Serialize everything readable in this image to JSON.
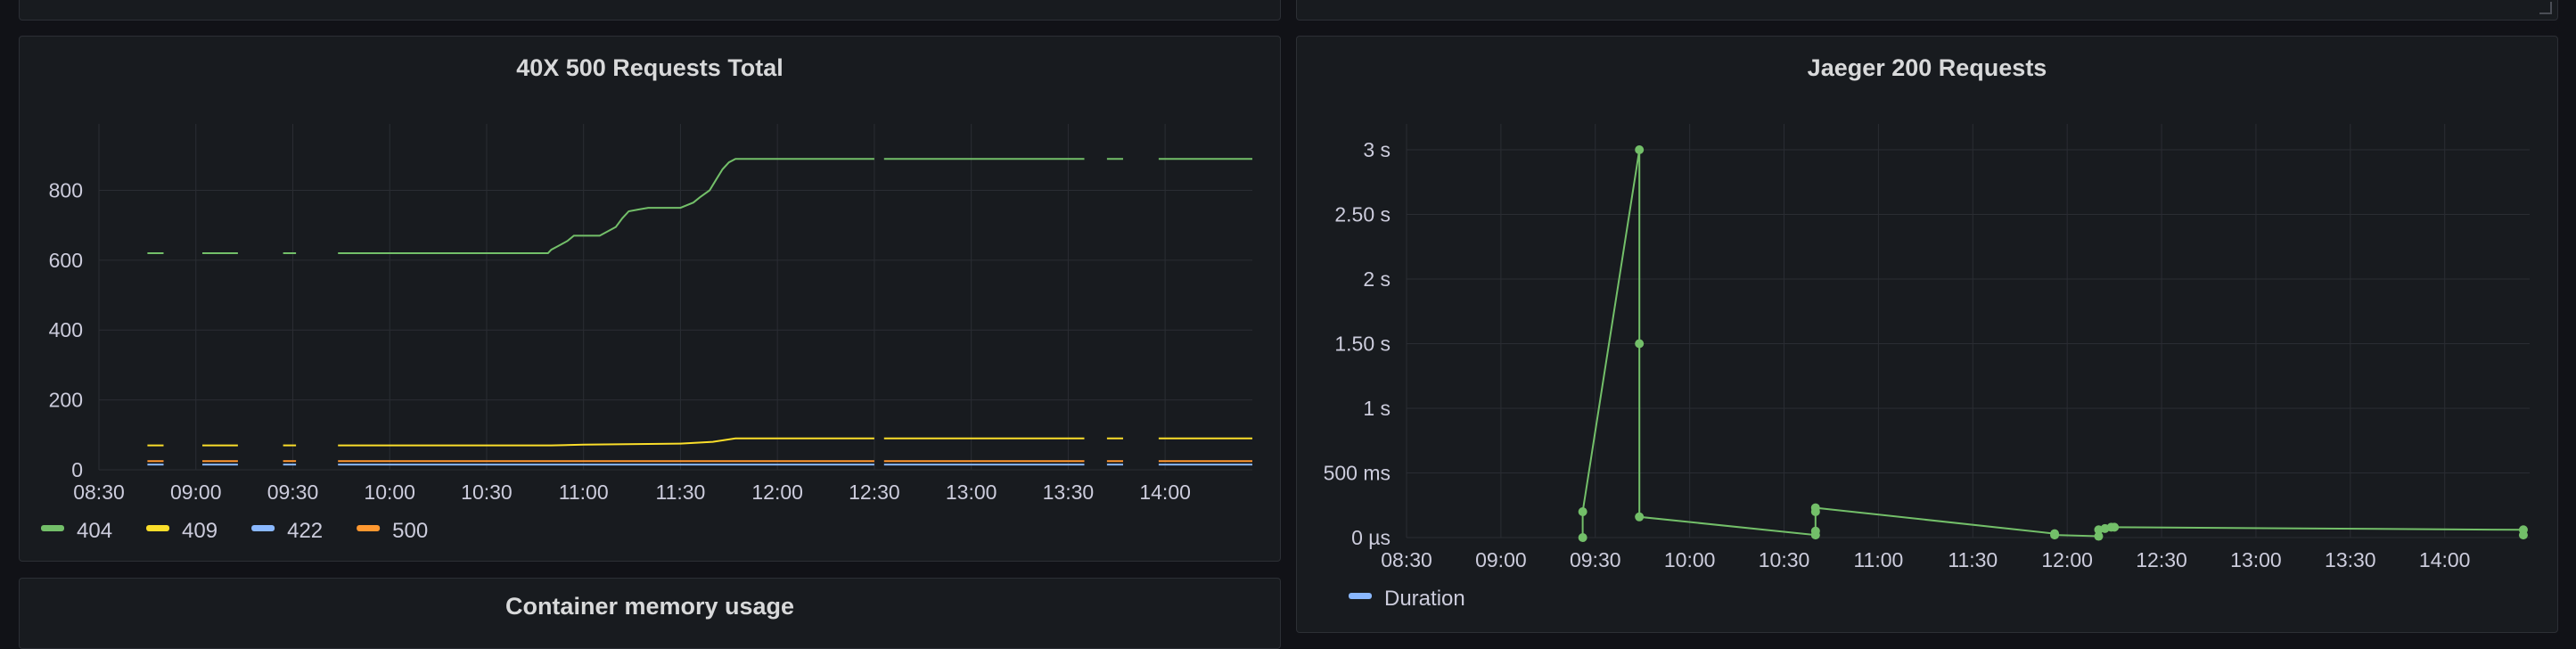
{
  "dashboard": {
    "panels": {
      "requests_total": {
        "title": "40X 500 Requests Total"
      },
      "jaeger": {
        "title": "Jaeger 200 Requests"
      },
      "memory": {
        "title": "Container memory usage"
      }
    }
  },
  "colors": {
    "404": "#73bf69",
    "409": "#fade2a",
    "422": "#8ab8ff",
    "500": "#ff9830",
    "Duration_line": "#73bf69",
    "Duration_legend": "#8ab8ff"
  },
  "chart_data": [
    {
      "type": "line",
      "title": "40X 500 Requests Total",
      "x_ticks": [
        "08:30",
        "09:00",
        "09:30",
        "10:00",
        "10:30",
        "11:00",
        "11:30",
        "12:00",
        "12:30",
        "13:00",
        "13:30",
        "14:00"
      ],
      "y_ticks": [
        "0",
        "200",
        "400",
        "600",
        "800"
      ],
      "xlim": [
        "08:30",
        "14:27"
      ],
      "ylim": [
        0,
        990
      ],
      "grid": true,
      "legend_position": "bottom-left",
      "series": [
        {
          "name": "404",
          "color": "#73bf69",
          "segments": [
            [
              [
                "08:45",
                620
              ],
              [
                "08:50",
                620
              ]
            ],
            [
              [
                "09:02",
                620
              ],
              [
                "09:13",
                620
              ]
            ],
            [
              [
                "09:27",
                620
              ],
              [
                "09:31",
                620
              ]
            ],
            [
              [
                "09:44",
                620
              ],
              [
                "10:00",
                620
              ],
              [
                "10:30",
                620
              ],
              [
                "10:49",
                620
              ],
              [
                "10:50",
                630
              ],
              [
                "10:52",
                640
              ],
              [
                "10:55",
                655
              ],
              [
                "10:57",
                670
              ],
              [
                "11:00",
                670
              ],
              [
                "11:05",
                670
              ],
              [
                "11:10",
                695
              ],
              [
                "11:12",
                720
              ],
              [
                "11:14",
                740
              ],
              [
                "11:17",
                745
              ],
              [
                "11:20",
                750
              ],
              [
                "11:30",
                750
              ],
              [
                "11:34",
                765
              ],
              [
                "11:36",
                780
              ],
              [
                "11:39",
                800
              ],
              [
                "11:41",
                830
              ],
              [
                "11:43",
                860
              ],
              [
                "11:45",
                880
              ],
              [
                "11:47",
                890
              ],
              [
                "12:30",
                890
              ]
            ],
            [
              [
                "12:33",
                890
              ],
              [
                "13:35",
                890
              ]
            ],
            [
              [
                "13:42",
                890
              ],
              [
                "13:47",
                890
              ]
            ],
            [
              [
                "13:58",
                890
              ],
              [
                "14:27",
                890
              ]
            ]
          ]
        },
        {
          "name": "409",
          "color": "#fade2a",
          "segments": [
            [
              [
                "08:45",
                70
              ],
              [
                "08:50",
                70
              ]
            ],
            [
              [
                "09:02",
                70
              ],
              [
                "09:13",
                70
              ]
            ],
            [
              [
                "09:27",
                70
              ],
              [
                "09:31",
                70
              ]
            ],
            [
              [
                "09:44",
                70
              ],
              [
                "10:50",
                70
              ],
              [
                "11:00",
                72
              ],
              [
                "11:30",
                75
              ],
              [
                "11:40",
                80
              ],
              [
                "11:47",
                90
              ],
              [
                "12:30",
                90
              ]
            ],
            [
              [
                "12:33",
                90
              ],
              [
                "13:35",
                90
              ]
            ],
            [
              [
                "13:42",
                90
              ],
              [
                "13:47",
                90
              ]
            ],
            [
              [
                "13:58",
                90
              ],
              [
                "14:27",
                90
              ]
            ]
          ]
        },
        {
          "name": "422",
          "color": "#8ab8ff",
          "segments": [
            [
              [
                "08:45",
                15
              ],
              [
                "08:50",
                15
              ]
            ],
            [
              [
                "09:02",
                15
              ],
              [
                "09:13",
                15
              ]
            ],
            [
              [
                "09:27",
                15
              ],
              [
                "09:31",
                15
              ]
            ],
            [
              [
                "09:44",
                15
              ],
              [
                "12:30",
                15
              ]
            ],
            [
              [
                "12:33",
                15
              ],
              [
                "13:35",
                15
              ]
            ],
            [
              [
                "13:42",
                15
              ],
              [
                "13:47",
                15
              ]
            ],
            [
              [
                "13:58",
                15
              ],
              [
                "14:27",
                15
              ]
            ]
          ]
        },
        {
          "name": "500",
          "color": "#ff9830",
          "segments": [
            [
              [
                "08:45",
                25
              ],
              [
                "08:50",
                25
              ]
            ],
            [
              [
                "09:02",
                25
              ],
              [
                "09:13",
                25
              ]
            ],
            [
              [
                "09:27",
                25
              ],
              [
                "09:31",
                25
              ]
            ],
            [
              [
                "09:44",
                25
              ],
              [
                "12:30",
                25
              ]
            ],
            [
              [
                "12:33",
                25
              ],
              [
                "13:35",
                25
              ]
            ],
            [
              [
                "13:42",
                25
              ],
              [
                "13:47",
                25
              ]
            ],
            [
              [
                "13:58",
                25
              ],
              [
                "14:27",
                25
              ]
            ]
          ]
        }
      ]
    },
    {
      "type": "line",
      "title": "Jaeger 200 Requests",
      "x_ticks": [
        "08:30",
        "09:00",
        "09:30",
        "10:00",
        "10:30",
        "11:00",
        "11:30",
        "12:00",
        "12:30",
        "13:00",
        "13:30",
        "14:00"
      ],
      "y_ticks": [
        "0 µs",
        "500 ms",
        "1 s",
        "1.50 s",
        "2 s",
        "2.50 s",
        "3 s"
      ],
      "y_tick_values": [
        0,
        0.5,
        1,
        1.5,
        2,
        2.5,
        3
      ],
      "xlim": [
        "08:30",
        "14:27"
      ],
      "ylim": [
        0,
        3.2
      ],
      "grid": true,
      "legend_position": "bottom-left",
      "series": [
        {
          "name": "Duration",
          "color": "#73bf69",
          "points": [
            [
              "09:26",
              0.0
            ],
            [
              "09:26",
              0.2
            ],
            [
              "09:44",
              3.0
            ],
            [
              "09:44",
              1.5
            ],
            [
              "09:44",
              0.16
            ],
            [
              "10:40",
              0.02
            ],
            [
              "10:40",
              0.05
            ],
            [
              "10:40",
              0.2
            ],
            [
              "10:40",
              0.23
            ],
            [
              "11:56",
              0.03
            ],
            [
              "11:56",
              0.02
            ],
            [
              "12:10",
              0.01
            ],
            [
              "12:10",
              0.06
            ],
            [
              "12:12",
              0.07
            ],
            [
              "12:14",
              0.08
            ],
            [
              "12:15",
              0.08
            ],
            [
              "14:25",
              0.06
            ],
            [
              "14:25",
              0.02
            ]
          ]
        }
      ]
    }
  ]
}
